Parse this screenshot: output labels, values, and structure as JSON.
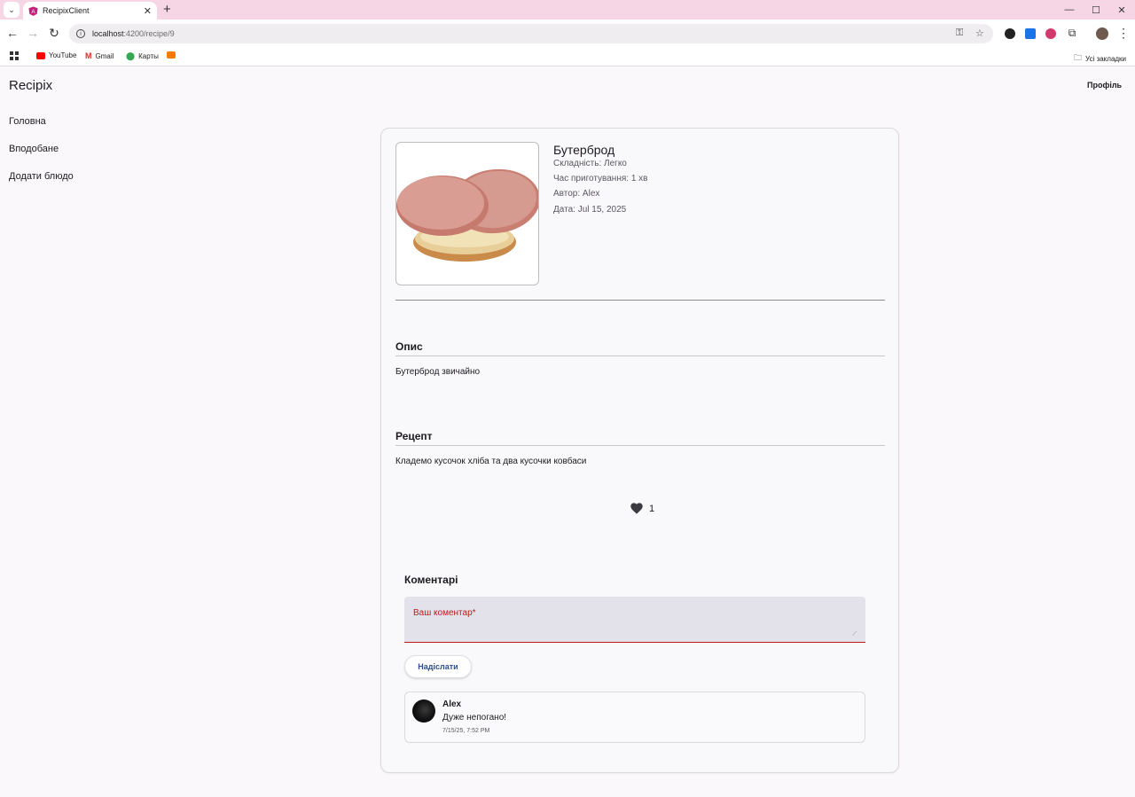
{
  "browser": {
    "tab_title": "RecipixClient",
    "url_host": "localhost",
    "url_path": ":4200/recipe/9",
    "bookmarks": [
      "YouTube",
      "Gmail",
      "Карты"
    ],
    "all_bookmarks": "Усі закладки"
  },
  "app": {
    "title": "Recipix",
    "profile": "Профіль"
  },
  "sidebar": {
    "items": [
      {
        "label": "Головна"
      },
      {
        "label": "Вподобане"
      },
      {
        "label": "Додати блюдо"
      }
    ]
  },
  "recipe": {
    "name": "Бутерброд",
    "difficulty_label": "Складність:",
    "difficulty": "Легко",
    "time_label": "Час приготування:",
    "time": "1 хв",
    "author_label": "Автор:",
    "author": "Alex",
    "date_label": "Дата:",
    "date": "Jul 15, 2025",
    "description_title": "Опис",
    "description": "Бутерброд звичайно",
    "recipe_title": "Рецепт",
    "recipe_text": "Кладемо кусочок хліба та два кусочки ковбаси",
    "likes": "1"
  },
  "comments": {
    "title": "Коментарі",
    "placeholder": "Ваш коментар*",
    "send_label": "Надіслати",
    "items": [
      {
        "author": "Alex",
        "text": "Дуже непогано!",
        "date": "7/15/25, 7:52 PM"
      }
    ]
  },
  "colors": {
    "accent": "#2b4f8a",
    "error": "#ba1a1a",
    "tabstrip": "#f6d6e4"
  }
}
